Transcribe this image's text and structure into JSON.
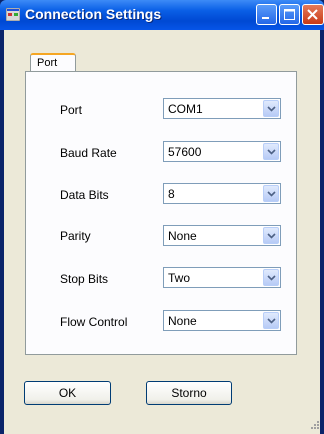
{
  "window": {
    "title": "Connection Settings"
  },
  "tabs": [
    {
      "label": "Port",
      "selected": true
    }
  ],
  "fields": [
    {
      "label": "Port",
      "value": "COM1"
    },
    {
      "label": "Baud Rate",
      "value": "57600"
    },
    {
      "label": "Data Bits",
      "value": "8"
    },
    {
      "label": "Parity",
      "value": "None"
    },
    {
      "label": "Stop Bits",
      "value": "Two"
    },
    {
      "label": "Flow Control",
      "value": "None"
    }
  ],
  "buttons": {
    "ok": "OK",
    "cancel": "Storno"
  },
  "colors": {
    "titlebar": "#0049d3",
    "client": "#ece9d8",
    "panel": "#fcfcfe",
    "tab_accent": "#f5a623"
  }
}
